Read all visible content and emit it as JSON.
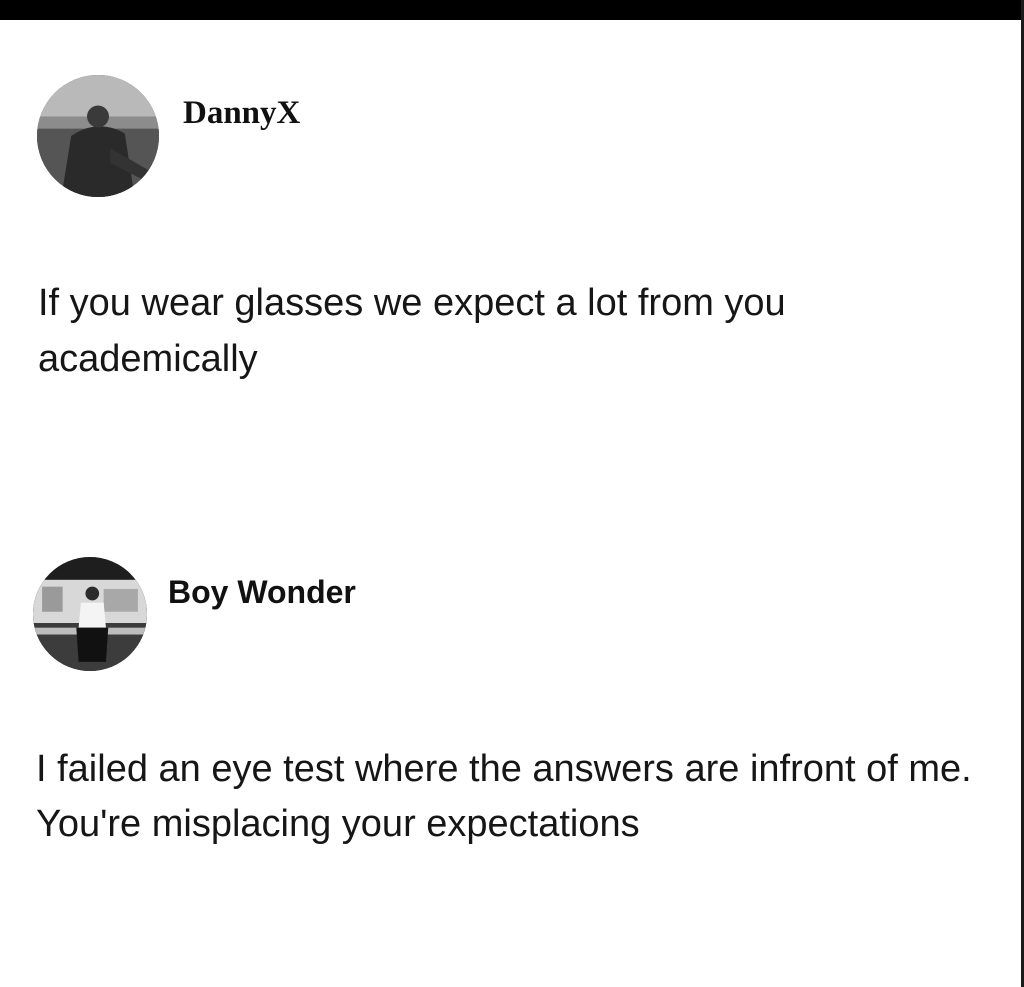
{
  "posts": [
    {
      "username": "DannyX",
      "text": "If you wear glasses we expect a lot from you academically",
      "avatar_icon": "profile-photo-person-outdoors"
    },
    {
      "username": "Boy Wonder",
      "text": "I failed an eye test where the answers are infront of me. You're misplacing your expectations",
      "avatar_icon": "profile-photo-person-sitting"
    }
  ],
  "colors": {
    "background": "#ffffff",
    "text": "#161616",
    "top_bar": "#000000"
  }
}
